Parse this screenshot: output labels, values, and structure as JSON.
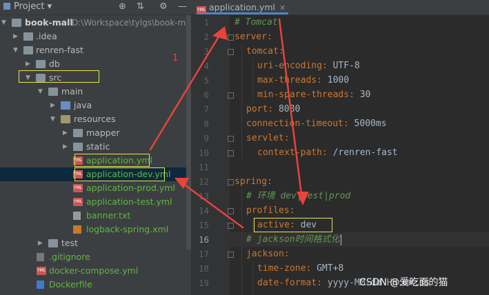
{
  "project_panel": {
    "title": "Project",
    "root_name": "book-mall",
    "root_path": "D:\\Workspace\\tylgs\\book-ma",
    "items": [
      {
        "label": ".idea"
      },
      {
        "label": "renren-fast"
      },
      {
        "label": "db"
      },
      {
        "label": "src"
      },
      {
        "label": "main"
      },
      {
        "label": "java"
      },
      {
        "label": "resources"
      },
      {
        "label": "mapper"
      },
      {
        "label": "static"
      },
      {
        "label": "application.yml"
      },
      {
        "label": "application-dev.yml"
      },
      {
        "label": "application-prod.yml"
      },
      {
        "label": "application-test.yml"
      },
      {
        "label": "banner.txt"
      },
      {
        "label": "logback-spring.xml"
      },
      {
        "label": "test"
      },
      {
        "label": ".gitignore"
      },
      {
        "label": "docker-compose.yml"
      },
      {
        "label": "Dockerfile"
      }
    ]
  },
  "editor": {
    "tab_label": "application.yml",
    "lines": [
      {
        "n": "1",
        "text": "# Tomcat"
      },
      {
        "n": "2",
        "key": "server",
        "val": ""
      },
      {
        "n": "3",
        "key": "tomcat",
        "val": ""
      },
      {
        "n": "4",
        "key": "uri-encoding",
        "val": "UTF-8"
      },
      {
        "n": "5",
        "key": "max-threads",
        "val": "1000"
      },
      {
        "n": "6",
        "key": "min-spare-threads",
        "val": "30"
      },
      {
        "n": "7",
        "key": "port",
        "val": "8080"
      },
      {
        "n": "8",
        "key": "connection-timeout",
        "val": "5000ms"
      },
      {
        "n": "9",
        "key": "servlet",
        "val": ""
      },
      {
        "n": "10",
        "key": "context-path",
        "val": "/renren-fast"
      },
      {
        "n": "11",
        "text": ""
      },
      {
        "n": "12",
        "key": "spring",
        "val": ""
      },
      {
        "n": "13",
        "text": "# 环境 dev|test|prod"
      },
      {
        "n": "14",
        "key": "profiles",
        "val": ""
      },
      {
        "n": "15",
        "key": "active",
        "val": "dev"
      },
      {
        "n": "16",
        "text": "# jackson时间格式化"
      },
      {
        "n": "17",
        "key": "jackson",
        "val": ""
      },
      {
        "n": "18",
        "key": "time-zone",
        "val": "GMT+8"
      },
      {
        "n": "19",
        "key": "date-format",
        "val": "yyyy-MM-dd HH:mm:ss"
      }
    ]
  },
  "annotation": {
    "label": "1"
  },
  "watermark": "CSDN @爱吃面的猫",
  "colors": {
    "keyword": "#cc7832",
    "comment": "#629755",
    "arrow": "#e8443a",
    "highlight_box": "#e8e84a"
  }
}
